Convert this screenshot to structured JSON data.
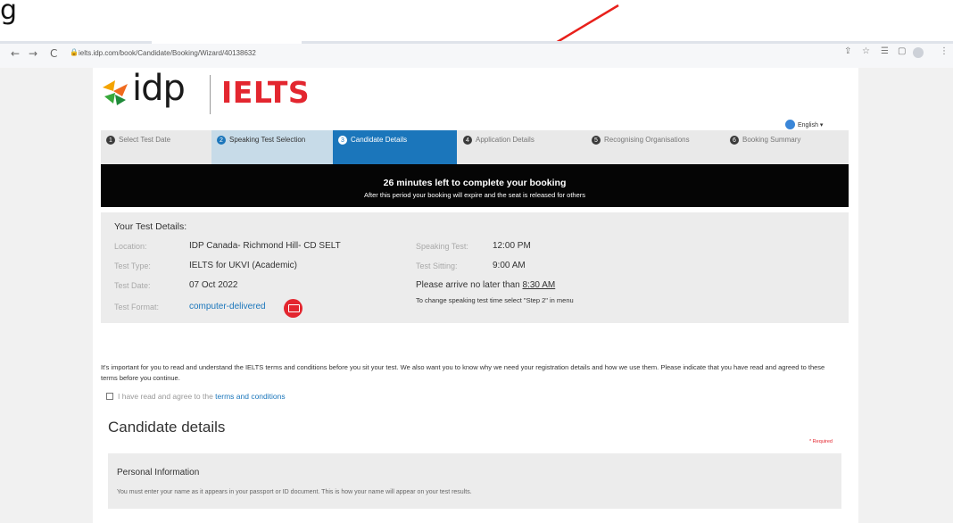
{
  "caption": "g",
  "browser": {
    "back": "←",
    "forward": "→",
    "reload": "C",
    "lock": "🔒",
    "url": "ielts.idp.com/book/Candidate/Booking/Wizard/40138632",
    "icons": [
      "share-icon",
      "star-icon",
      "reading-list-icon",
      "sidepanel-icon",
      "profile-icon",
      "menu-icon"
    ]
  },
  "logo": {
    "idp": "idp",
    "ielts": "IELTS"
  },
  "language": {
    "label": "English ▾"
  },
  "steps": [
    {
      "num": "1",
      "label": "Select Test Date",
      "state": "default"
    },
    {
      "num": "2",
      "label": "Speaking Test Selection",
      "state": "done"
    },
    {
      "num": "3",
      "label": "Candidate Details",
      "state": "current"
    },
    {
      "num": "4",
      "label": "Application Details",
      "state": "default"
    },
    {
      "num": "5",
      "label": "Recognising Organisations",
      "state": "default"
    },
    {
      "num": "6",
      "label": "Booking Summary",
      "state": "default"
    }
  ],
  "banner": {
    "title": "26 minutes left to complete your booking",
    "subtitle": "After this period your booking will expire and the seat is released for others"
  },
  "details": {
    "title": "Your Test Details:",
    "location_label": "Location:",
    "location": "IDP Canada- Richmond Hill- CD SELT",
    "type_label": "Test Type:",
    "type": "IELTS for UKVI (Academic)",
    "date_label": "Test Date:",
    "date": "07 Oct 2022",
    "format_label": "Test Format:",
    "format": "computer-delivered",
    "speaking_label": "Speaking Test:",
    "speaking": "12:00 PM",
    "sitting_label": "Test Sitting:",
    "sitting": "9:00 AM",
    "arrive_prefix": "Please arrive no later than ",
    "arrive_time": "8:30 AM",
    "change_note": "To change speaking test time select \"Step 2\" in menu"
  },
  "intro": "It's important for you to read and understand the IELTS terms and conditions before you sit your test. We also want you to know why we need your registration details and how we use them. Please indicate that you have read and agreed to these terms before you continue.",
  "agree": {
    "prefix": "I have read and agree to the ",
    "link": "terms and conditions"
  },
  "candidate": {
    "title": "Candidate details",
    "required": "* Required",
    "personal_title": "Personal Information",
    "personal_note": "You must enter your name as it appears in your passport or ID document. This is how your name will appear on your test results."
  },
  "colors": {
    "accent": "#1b76bb",
    "brand_red": "#e3262f",
    "banner": "#050505",
    "annotation_arrow": "#e8201b"
  }
}
